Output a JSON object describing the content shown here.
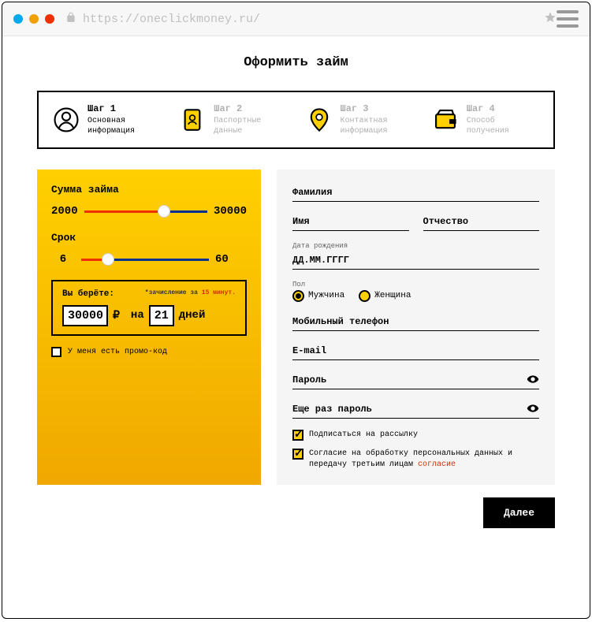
{
  "browser": {
    "url": "https://oneclickmoney.ru/"
  },
  "page_title": "Оформить займ",
  "steps": [
    {
      "num": "Шаг 1",
      "label": "Основная информация"
    },
    {
      "num": "Шаг 2",
      "label": "Паспортные данные"
    },
    {
      "num": "Шаг 3",
      "label": "Контактная информация"
    },
    {
      "num": "Шаг 4",
      "label": "Способ получения"
    }
  ],
  "calc": {
    "amount_label": "Сумма займа",
    "amount_min": "2000",
    "amount_max": "30000",
    "term_label": "Срок",
    "term_min": "6",
    "term_max": "60",
    "summary_title": "Вы берёте:",
    "summary_note_prefix": "*зачисление за ",
    "summary_note_hl": "15 минут.",
    "amount_value": "30000",
    "currency": "₽",
    "on_label": "на",
    "days_value": "21",
    "days_label": "дней",
    "promo_label": "У меня есть промо-код"
  },
  "form": {
    "lastname": "Фамилия",
    "firstname": "Имя",
    "patronymic": "Отчество",
    "dob_label": "Дата рождения",
    "dob_placeholder": "ДД.ММ.ГГГГ",
    "gender_label": "Пол",
    "gender_male": "Мужчина",
    "gender_female": "Женщина",
    "phone": "Мобильный телефон",
    "email": "E-mail",
    "password": "Пароль",
    "password2": "Еще раз пароль",
    "subscribe": "Подписаться на рассылку",
    "consent": "Согласие на обработку персональных данных и передачу третьим лицам ",
    "consent_link": "согласие"
  },
  "next_button": "Далее"
}
